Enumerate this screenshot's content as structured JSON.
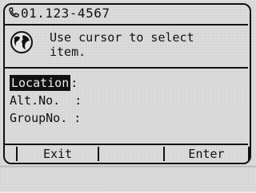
{
  "header": {
    "phone_icon": "handset-icon",
    "phone_number": "01.123-4567"
  },
  "message": {
    "icon": "globe-icon",
    "line1": "Use cursor to select",
    "line2": "item."
  },
  "fields": [
    {
      "label": "Location",
      "sep": ":",
      "value": ""
    },
    {
      "label": "Alt.No.",
      "sep": ":",
      "value": ""
    },
    {
      "label": "GroupNo.",
      "sep": ":",
      "value": ""
    }
  ],
  "softkeys": {
    "left": "Exit",
    "right": "Enter"
  },
  "colors": {
    "background": "#e6e6e6",
    "foreground": "#111111",
    "highlight_bg": "#111111",
    "highlight_fg": "#eeeeee"
  }
}
